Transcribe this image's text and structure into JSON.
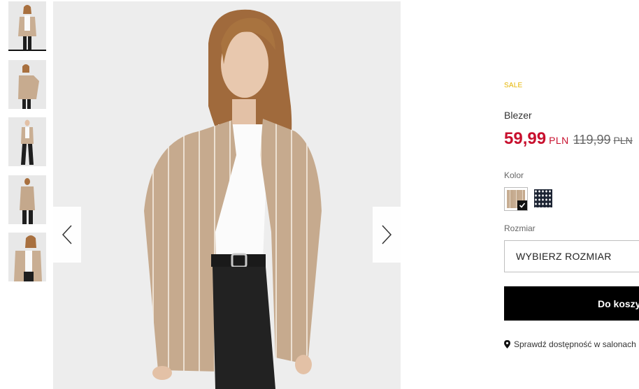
{
  "gallery": {
    "thumbnails": [
      {
        "alt": "thumbnail-front",
        "active": true
      },
      {
        "alt": "thumbnail-side",
        "active": false
      },
      {
        "alt": "thumbnail-full",
        "active": false
      },
      {
        "alt": "thumbnail-back",
        "active": false
      },
      {
        "alt": "thumbnail-detail",
        "active": false
      }
    ],
    "prev_icon": "chevron-left-icon",
    "next_icon": "chevron-right-icon"
  },
  "product": {
    "badge": "SALE",
    "name": "Blezer",
    "price_new": "59,99",
    "currency_new": "PLN",
    "price_old": "119,99",
    "currency_old": "PLN"
  },
  "color": {
    "label": "Kolor",
    "options": [
      {
        "name": "beige-stripes",
        "selected": true
      },
      {
        "name": "navy-pattern",
        "selected": false
      }
    ]
  },
  "size": {
    "label": "Rozmiar",
    "placeholder": "WYBIERZ ROZMIAR"
  },
  "cart": {
    "label": "Do koszyka",
    "icon": "shopping-bag-icon"
  },
  "availability": {
    "text": "Sprawdź dostępność w salonach",
    "icon": "map-pin-icon"
  },
  "colors": {
    "sale": "#e5b400",
    "price": "#c8102e",
    "button": "#000000"
  }
}
